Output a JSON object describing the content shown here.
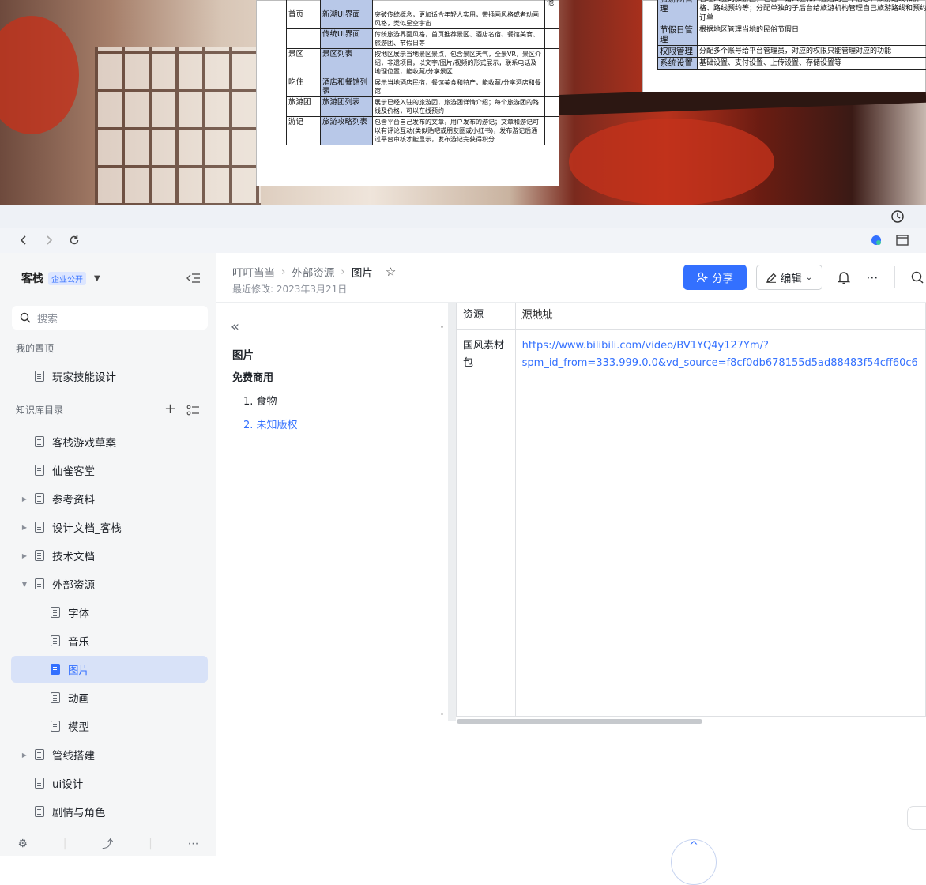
{
  "background_docs": {
    "doc1": {
      "top_fragment": "他",
      "rows": [
        {
          "section": "首页",
          "feature": "新潮UI界面",
          "desc": "突破传统概念，更加适合年轻人实用，带插画风格或者动画风格，类似星空宇宙"
        },
        {
          "section": "",
          "feature": "传统UI界面",
          "desc": "传统旅游界面风格，首页推荐景区、酒店名宿、餐馆美食、旅游团、节假日等"
        },
        {
          "section": "景区",
          "feature": "景区列表",
          "desc": "按地区展示当地景区景点，包含景区天气，全景VR，景区介绍，非遗项目，以文字/图片/视频的形式展示，联系电话及地理位置，能收藏/分享景区"
        },
        {
          "section": "吃住",
          "feature": "酒店和餐馆列表",
          "desc": "展示当地酒店民宿，餐馆美食和特产，能收藏/分享酒店和餐馆"
        },
        {
          "section": "旅游团",
          "feature": "旅游团列表",
          "desc": "展示已经入驻的旅游团，旅游团详情介绍；每个旅游团的路线及价格，可以在线预约"
        },
        {
          "section": "游记",
          "feature": "旅游攻略列表",
          "desc": "包含平台自己发布的文章，用户发布的游记；文章和游记可以有评论互动(类似贴吧或朋友圈或小红书)，发布游记后通过平台审核才能显示，发布游记完获得积分"
        }
      ]
    },
    "doc2": {
      "rows": [
        {
          "key": "旅游团管理",
          "value": "管理入驻的旅游团，包含申请入驻和入驻后的基本信息、旅游路线和价格、路线预约等；分配单独的子后台给旅游机构管理自己旅游路线和预约订单"
        },
        {
          "key": "节假日管理",
          "value": "根据地区管理当地的民俗节假日"
        },
        {
          "key": "权限管理",
          "value": "分配多个账号给平台管理员，对应的权限只能管理对应的功能"
        },
        {
          "key": "系统设置",
          "value": "基础设置、支付设置、上传设置、存储设置等"
        }
      ]
    }
  },
  "sidebar": {
    "space_name": "客栈",
    "space_badge": "企业公开",
    "search_placeholder": "搜索",
    "pinned_label": "我的置顶",
    "pinned": [
      {
        "label": "玩家技能设计"
      }
    ],
    "catalog_label": "知识库目录",
    "tree": [
      {
        "label": "客栈游戏草案",
        "level": 0,
        "caret": ""
      },
      {
        "label": "仙雀客堂",
        "level": 0,
        "caret": ""
      },
      {
        "label": "参考资料",
        "level": 0,
        "caret": "▶"
      },
      {
        "label": "设计文档_客栈",
        "level": 0,
        "caret": "▶"
      },
      {
        "label": "技术文档",
        "level": 0,
        "caret": "▶"
      },
      {
        "label": "外部资源",
        "level": 0,
        "caret": "▼"
      },
      {
        "label": "字体",
        "level": 1,
        "caret": ""
      },
      {
        "label": "音乐",
        "level": 1,
        "caret": ""
      },
      {
        "label": "图片",
        "level": 1,
        "caret": "",
        "active": true
      },
      {
        "label": "动画",
        "level": 1,
        "caret": ""
      },
      {
        "label": "模型",
        "level": 1,
        "caret": ""
      },
      {
        "label": "管线搭建",
        "level": 0,
        "caret": "▶"
      },
      {
        "label": "ui设计",
        "level": 0,
        "caret": ""
      },
      {
        "label": "剧情与角色",
        "level": 0,
        "caret": ""
      }
    ]
  },
  "header": {
    "breadcrumbs": [
      "叮叮当当",
      "外部资源",
      "图片"
    ],
    "modified": "最近修改: 2023年3月21日",
    "share_label": "分享",
    "edit_label": "编辑"
  },
  "outline": {
    "title": "图片",
    "h2": "免费商用",
    "items": [
      "1. 食物",
      "2. 未知版权"
    ]
  },
  "table": {
    "headers": [
      "资源",
      "源地址"
    ],
    "rows": [
      {
        "name": "国风素材包",
        "url_line1": "https://www.bilibili.com/video/BV1YQ4y127Ym/?",
        "url_line2": "spm_id_from=333.999.0.0&vd_source=f8cf0db678155d5ad88483f54cff60c6"
      }
    ]
  },
  "colors": {
    "accent": "#3370ff",
    "sidebar_bg": "#f5f6f7",
    "active_item_bg": "#d8e2f8"
  }
}
